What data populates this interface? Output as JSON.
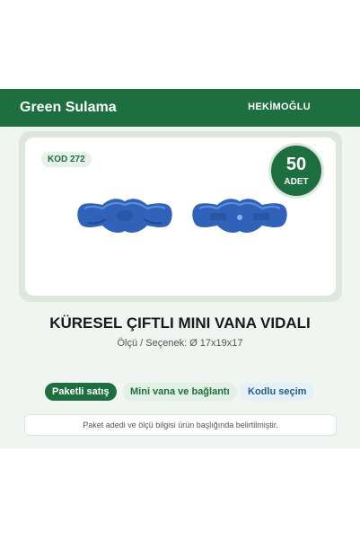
{
  "header": {
    "brand": "Green Sulama",
    "maker": "HEKİMOĞLU"
  },
  "product": {
    "code": "KOD 272",
    "quantity": "50",
    "quantity_unit": "ADET",
    "title": "KÜRESEL ÇIFTLI MINI VANA VIDALI",
    "subtitle": "Ölçü / Seçenek: Ø 17x19x17",
    "image_icon": "blue-valve-part-icon"
  },
  "tags": [
    {
      "label": "Paketli satış"
    },
    {
      "label": "Mini vana ve bağlantı"
    },
    {
      "label": "Kodlu seçim"
    }
  ],
  "note": "Paket adedi ve ölçü bilgisi ürün başlığında belirtilmiştir.",
  "colors": {
    "brand_green": "#1d6f3f",
    "part_blue": "#2f62b8",
    "tag_blue_text": "#1f5f8c"
  }
}
